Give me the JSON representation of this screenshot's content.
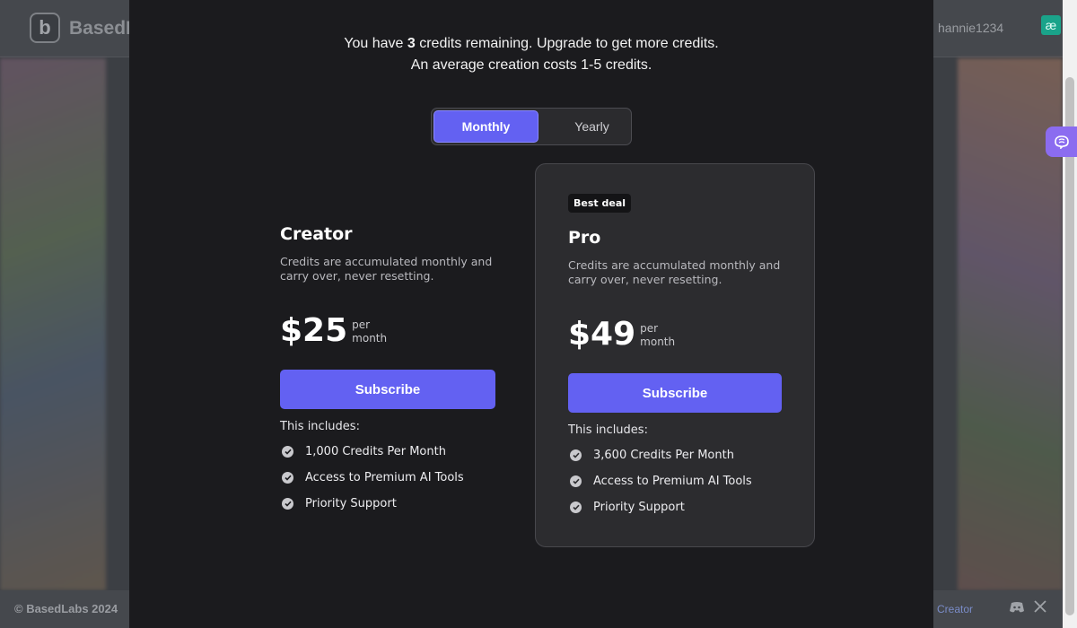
{
  "background": {
    "brand": "BasedL",
    "username": "hannie1234",
    "extension_icon": "æ",
    "copyright": "© BasedLabs 2024",
    "footer_creator": "Creator",
    "footer_icons": [
      "discord-icon",
      "x-icon"
    ]
  },
  "modal": {
    "notice_prefix": "You have ",
    "credits": "3",
    "notice_suffix": " credits remaining. Upgrade to get more credits.",
    "notice_line2": "An average creation costs 1-5 credits.",
    "billing_toggle": {
      "monthly": "Monthly",
      "yearly": "Yearly",
      "selected": "Monthly"
    },
    "plans": [
      {
        "name": "Creator",
        "description": "Credits are accumulated monthly and carry over, never resetting.",
        "price": "$25",
        "per_top": "per",
        "per_bottom": "month",
        "button": "Subscribe",
        "includes_label": "This includes:",
        "features": [
          "1,000 Credits Per Month",
          "Access to Premium AI Tools",
          "Priority Support"
        ]
      },
      {
        "badge": "Best deal",
        "name": "Pro",
        "description": "Credits are accumulated monthly and carry over, never resetting.",
        "price": "$49",
        "per_top": "per",
        "per_bottom": "month",
        "button": "Subscribe",
        "includes_label": "This includes:",
        "features": [
          "3,600 Credits Per Month",
          "Access to Premium AI Tools",
          "Priority Support"
        ]
      }
    ]
  },
  "colors": {
    "accent": "#6361f2",
    "modal_bg": "#1b1b1e",
    "card_bg": "#2c2c2f"
  }
}
